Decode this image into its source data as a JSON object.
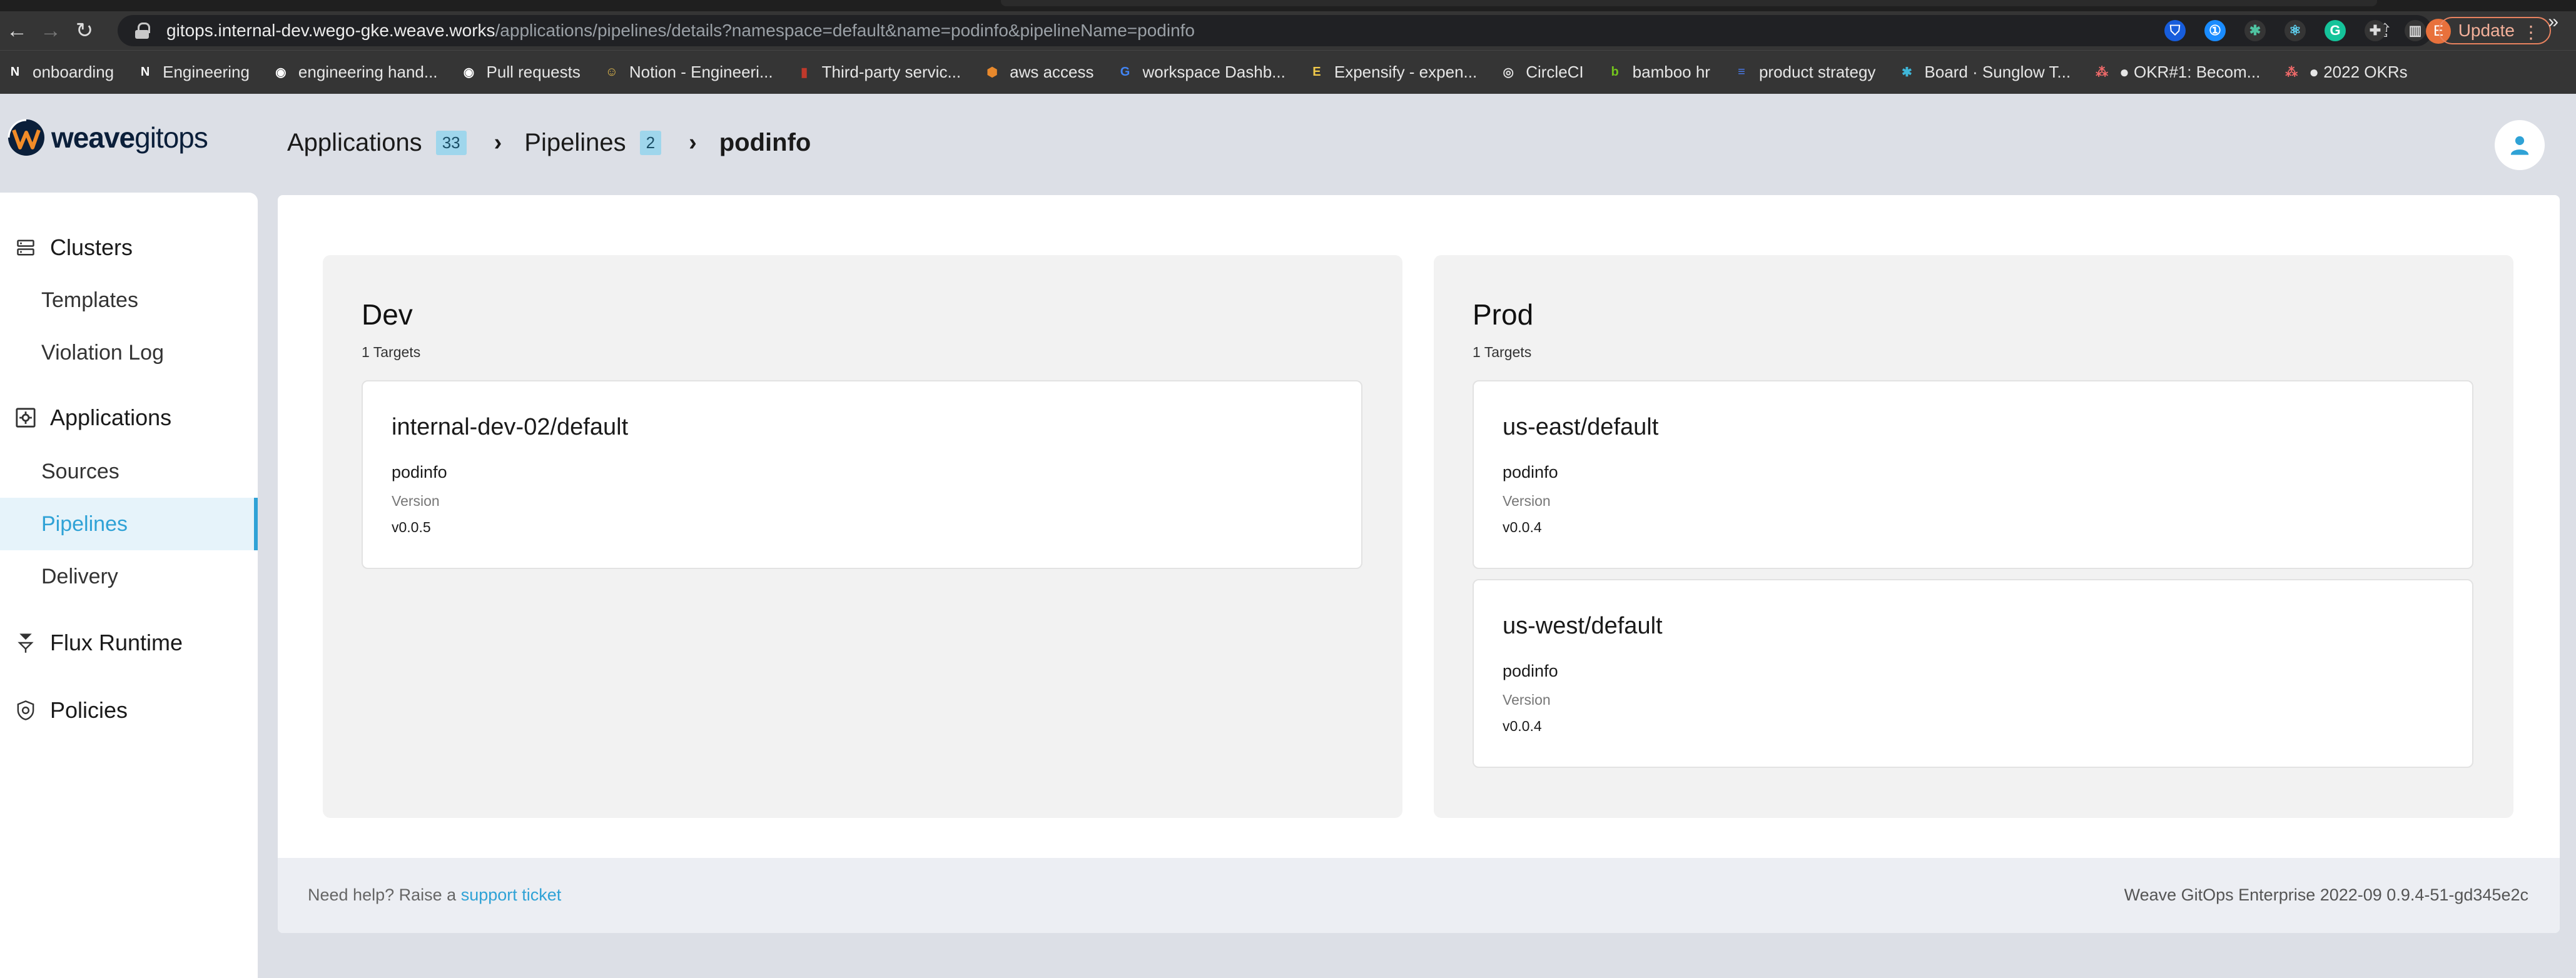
{
  "browser": {
    "url_host": "gitops.internal-dev.wego-gke.weave.works",
    "url_path": "/applications/pipelines/details?namespace=default&name=podinfo&pipelineName=podinfo",
    "update_label": "Update",
    "profile_initial": "E",
    "bookmarks": [
      {
        "label": "onboarding",
        "icon": "notion-icon",
        "color": "#ffffff"
      },
      {
        "label": "Engineering",
        "icon": "notion-icon",
        "color": "#ffffff"
      },
      {
        "label": "engineering hand...",
        "icon": "github-icon",
        "color": "#ffffff"
      },
      {
        "label": "Pull requests",
        "icon": "github-icon",
        "color": "#ffffff"
      },
      {
        "label": "Notion - Engineeri...",
        "icon": "notion-avatar-icon",
        "color": "#e0b84c"
      },
      {
        "label": "Third-party servic...",
        "icon": "bookmark-red-icon",
        "color": "#c0392b"
      },
      {
        "label": "aws access",
        "icon": "aws-cube-icon",
        "color": "#e8892c"
      },
      {
        "label": "workspace Dashb...",
        "icon": "google-icon",
        "color": "#4285f4"
      },
      {
        "label": "Expensify - expen...",
        "icon": "expensify-icon",
        "color": "#f0c94a"
      },
      {
        "label": "CircleCI",
        "icon": "circleci-icon",
        "color": "#dddddd"
      },
      {
        "label": "bamboo hr",
        "icon": "bamboohr-icon",
        "color": "#73c41d"
      },
      {
        "label": "product strategy",
        "icon": "google-docs-icon",
        "color": "#4a7cf0"
      },
      {
        "label": "Board · Sunglow T...",
        "icon": "asterisk-icon",
        "color": "#3fb6d8"
      },
      {
        "label": "● OKR#1: Becom...",
        "icon": "asana-icon",
        "color": "#f06a6a"
      },
      {
        "label": "● 2022 OKRs",
        "icon": "asana-icon",
        "color": "#f06a6a"
      }
    ],
    "bookmarks_more": "»"
  },
  "app": {
    "logo_weave": "weave",
    "logo_gitops": "gitops",
    "breadcrumb": {
      "applications_label": "Applications",
      "applications_count": "33",
      "pipelines_label": "Pipelines",
      "pipelines_count": "2",
      "current": "podinfo"
    }
  },
  "sidebar": {
    "clusters": "Clusters",
    "templates": "Templates",
    "violation_log": "Violation Log",
    "applications": "Applications",
    "sources": "Sources",
    "pipelines": "Pipelines",
    "delivery": "Delivery",
    "flux_runtime": "Flux Runtime",
    "policies": "Policies",
    "accent_color": "#2fa2d6"
  },
  "stages": [
    {
      "name": "Dev",
      "targets_count": "1 Targets",
      "targets": [
        {
          "name": "internal-dev-02/default",
          "app": "podinfo",
          "version_label": "Version",
          "version": "v0.0.5"
        }
      ]
    },
    {
      "name": "Prod",
      "targets_count": "1 Targets",
      "targets": [
        {
          "name": "us-east/default",
          "app": "podinfo",
          "version_label": "Version",
          "version": "v0.0.4"
        },
        {
          "name": "us-west/default",
          "app": "podinfo",
          "version_label": "Version",
          "version": "v0.0.4"
        }
      ]
    }
  ],
  "footer": {
    "help_text": "Need help? Raise a",
    "help_link": "support ticket",
    "version": "Weave GitOps Enterprise 2022-09 0.9.4-51-gd345e2c"
  }
}
